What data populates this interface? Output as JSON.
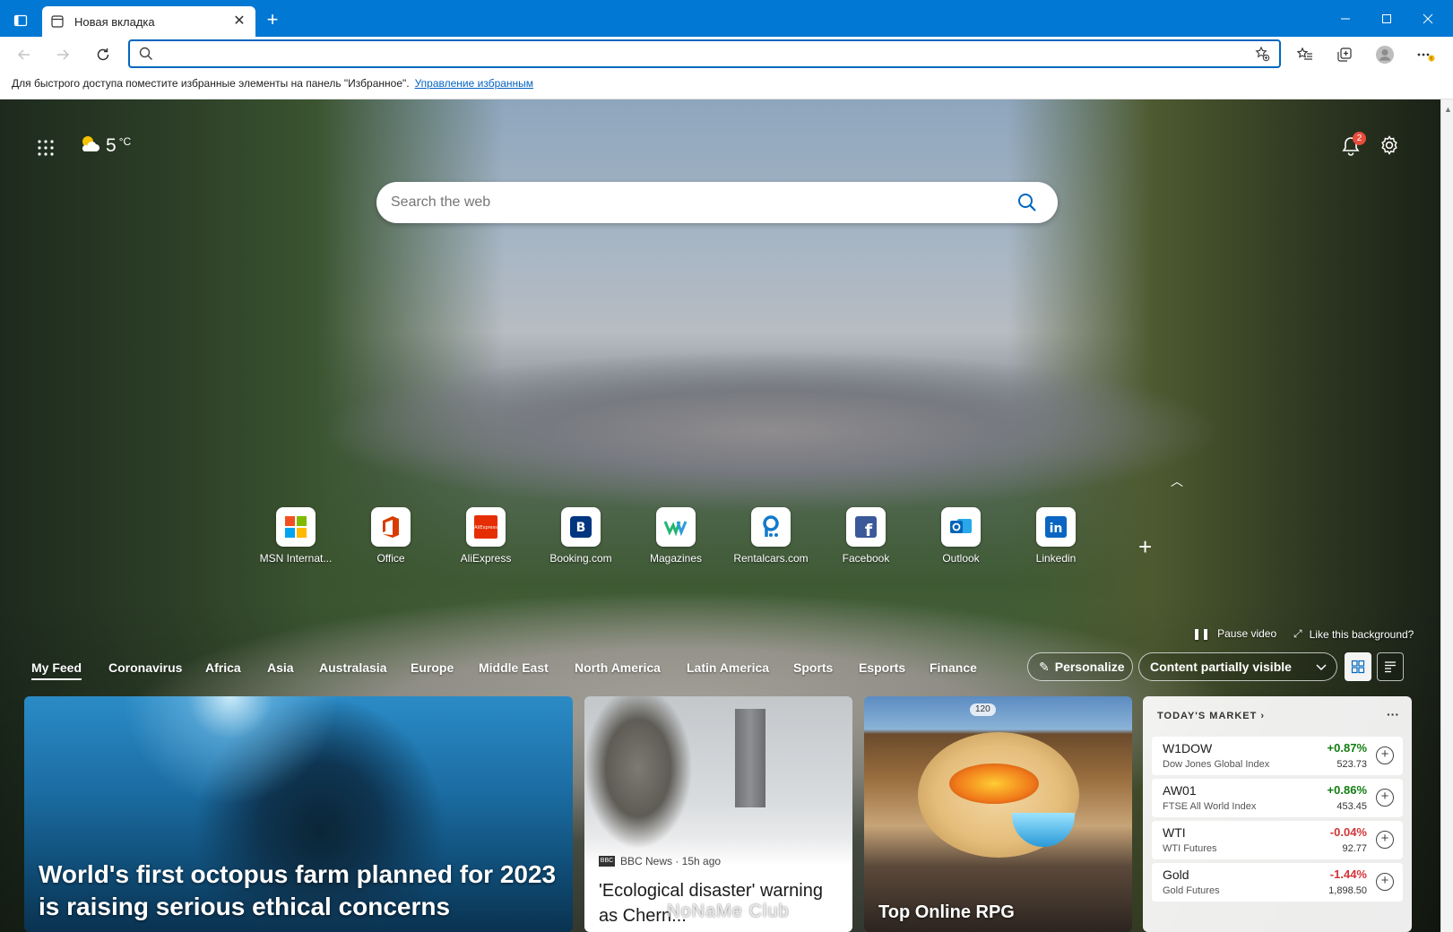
{
  "colors": {
    "accent": "#0078d4",
    "up": "#107c10",
    "down": "#d13438"
  },
  "browser": {
    "tab_title": "Новая вкладка",
    "new_tab_label": "+",
    "favbar_text": "Для быстрого доступа поместите избранные элементы на панель \"Избранное\".",
    "favbar_link": "Управление избранным",
    "address_value": ""
  },
  "icons": {
    "tab_actions": "tab-actions-icon",
    "back": "back-arrow-icon",
    "forward": "forward-arrow-icon",
    "refresh": "refresh-icon",
    "search": "search-icon",
    "add_favorite": "star-plus-icon",
    "favorites": "favorites-icon",
    "collections": "collections-icon",
    "profile": "profile-avatar-icon",
    "menu": "more-menu-icon"
  },
  "ntp": {
    "weather_temp": "5",
    "weather_unit": "°C",
    "notification_count": "2",
    "search_placeholder": "Search the web",
    "quick_links": [
      {
        "label": "MSN Internat..."
      },
      {
        "label": "Office"
      },
      {
        "label": "AliExpress"
      },
      {
        "label": "Booking.com"
      },
      {
        "label": "Magazines"
      },
      {
        "label": "Rentalcars.com"
      },
      {
        "label": "Facebook"
      },
      {
        "label": "Outlook"
      },
      {
        "label": "Linkedin"
      }
    ],
    "add_link": "+",
    "pause_video": "Pause video",
    "like_background": "Like this background?"
  },
  "feed": {
    "tabs": [
      "My Feed",
      "Coronavirus",
      "Africa",
      "Asia",
      "Australasia",
      "Europe",
      "Middle East",
      "North America",
      "Latin America",
      "Sports",
      "Esports",
      "Finance"
    ],
    "personalize": "Personalize",
    "visibility": "Content partially visible",
    "cards": {
      "main_headline": "World's first octopus farm planned for 2023 is raising serious ethical concerns",
      "news_source": "BBC News · 15h ago",
      "news_source_logo": "BBC",
      "news_headline": "'Ecological disaster' warning as Chern...",
      "game_coins": "120",
      "game_headline": "Top Online RPG"
    },
    "market": {
      "title": "TODAY'S MARKET",
      "more": "···",
      "rows": [
        {
          "symbol": "W1DOW",
          "name": "Dow Jones Global Index",
          "change": "+0.87%",
          "value": "523.73"
        },
        {
          "symbol": "AW01",
          "name": "FTSE All World Index",
          "change": "+0.86%",
          "value": "453.45"
        },
        {
          "symbol": "WTI",
          "name": "WTI Futures",
          "change": "-0.04%",
          "value": "92.77"
        },
        {
          "symbol": "Gold",
          "name": "Gold Futures",
          "change": "-1.44%",
          "value": "1,898.50"
        }
      ]
    }
  },
  "watermark": "NoNaMe Club"
}
